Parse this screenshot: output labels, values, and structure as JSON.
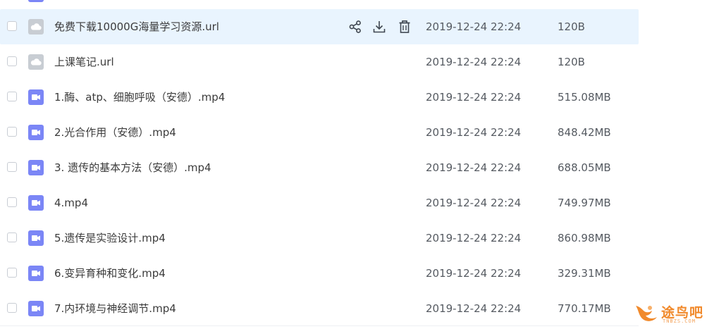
{
  "files": [
    {
      "name": "免费下载10000G海量学习资源.url",
      "date": "2019-12-24 22:24",
      "size": "120B",
      "type": "url-icon"
    },
    {
      "name": "上课笔记.url",
      "date": "2019-12-24 22:24",
      "size": "120B",
      "type": "url-icon"
    },
    {
      "name": "1.酶、atp、细胞呼吸（安德）.mp4",
      "date": "2019-12-24 22:24",
      "size": "515.08MB",
      "type": "video-icon"
    },
    {
      "name": "2.光合作用（安德）.mp4",
      "date": "2019-12-24 22:24",
      "size": "848.42MB",
      "type": "video-icon"
    },
    {
      "name": "3. 遗传的基本方法（安德）.mp4",
      "date": "2019-12-24 22:24",
      "size": "688.05MB",
      "type": "video-icon"
    },
    {
      "name": "4.mp4",
      "date": "2019-12-24 22:24",
      "size": "749.97MB",
      "type": "video-icon"
    },
    {
      "name": "5.遗传是实验设计.mp4",
      "date": "2019-12-24 22:24",
      "size": "860.98MB",
      "type": "video-icon"
    },
    {
      "name": "6.变异育种和变化.mp4",
      "date": "2019-12-24 22:24",
      "size": "329.31MB",
      "type": "video-icon"
    },
    {
      "name": "7.内环境与神经调节.mp4",
      "date": "2019-12-24 22:24",
      "size": "770.17MB",
      "type": "video-icon"
    }
  ],
  "hover_actions": [
    "share-icon",
    "download-icon",
    "delete-icon"
  ],
  "watermark": {
    "text": "途鸟吧",
    "sub": "TNBZS.COM"
  },
  "colors": {
    "highlight": "#e9f4fe",
    "video_icon": "#7b86f6",
    "url_icon": "#c8cdd3",
    "watermark": "#f18a2c"
  }
}
